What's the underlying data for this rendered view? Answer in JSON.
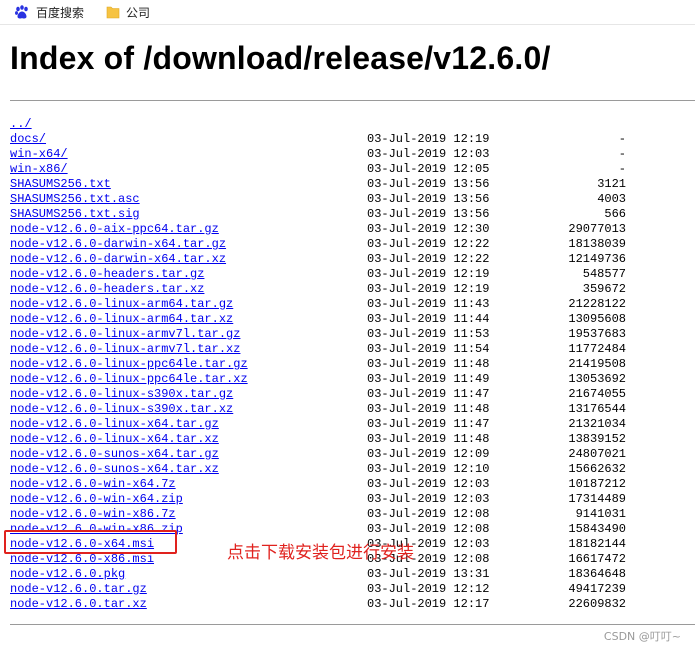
{
  "bookmarks": [
    {
      "label": "百度搜索",
      "icon": "paw-icon"
    },
    {
      "label": "公司",
      "icon": "folder-icon"
    }
  ],
  "page_title": "Index of /download/release/v12.6.0/",
  "entries": [
    {
      "name": "../",
      "date": "",
      "size": ""
    },
    {
      "name": "docs/",
      "date": "03-Jul-2019 12:19",
      "size": "-"
    },
    {
      "name": "win-x64/",
      "date": "03-Jul-2019 12:03",
      "size": "-"
    },
    {
      "name": "win-x86/",
      "date": "03-Jul-2019 12:05",
      "size": "-"
    },
    {
      "name": "SHASUMS256.txt",
      "date": "03-Jul-2019 13:56",
      "size": "3121"
    },
    {
      "name": "SHASUMS256.txt.asc",
      "date": "03-Jul-2019 13:56",
      "size": "4003"
    },
    {
      "name": "SHASUMS256.txt.sig",
      "date": "03-Jul-2019 13:56",
      "size": "566"
    },
    {
      "name": "node-v12.6.0-aix-ppc64.tar.gz",
      "date": "03-Jul-2019 12:30",
      "size": "29077013"
    },
    {
      "name": "node-v12.6.0-darwin-x64.tar.gz",
      "date": "03-Jul-2019 12:22",
      "size": "18138039"
    },
    {
      "name": "node-v12.6.0-darwin-x64.tar.xz",
      "date": "03-Jul-2019 12:22",
      "size": "12149736"
    },
    {
      "name": "node-v12.6.0-headers.tar.gz",
      "date": "03-Jul-2019 12:19",
      "size": "548577"
    },
    {
      "name": "node-v12.6.0-headers.tar.xz",
      "date": "03-Jul-2019 12:19",
      "size": "359672"
    },
    {
      "name": "node-v12.6.0-linux-arm64.tar.gz",
      "date": "03-Jul-2019 11:43",
      "size": "21228122"
    },
    {
      "name": "node-v12.6.0-linux-arm64.tar.xz",
      "date": "03-Jul-2019 11:44",
      "size": "13095608"
    },
    {
      "name": "node-v12.6.0-linux-armv7l.tar.gz",
      "date": "03-Jul-2019 11:53",
      "size": "19537683"
    },
    {
      "name": "node-v12.6.0-linux-armv7l.tar.xz",
      "date": "03-Jul-2019 11:54",
      "size": "11772484"
    },
    {
      "name": "node-v12.6.0-linux-ppc64le.tar.gz",
      "date": "03-Jul-2019 11:48",
      "size": "21419508"
    },
    {
      "name": "node-v12.6.0-linux-ppc64le.tar.xz",
      "date": "03-Jul-2019 11:49",
      "size": "13053692"
    },
    {
      "name": "node-v12.6.0-linux-s390x.tar.gz",
      "date": "03-Jul-2019 11:47",
      "size": "21674055"
    },
    {
      "name": "node-v12.6.0-linux-s390x.tar.xz",
      "date": "03-Jul-2019 11:48",
      "size": "13176544"
    },
    {
      "name": "node-v12.6.0-linux-x64.tar.gz",
      "date": "03-Jul-2019 11:47",
      "size": "21321034"
    },
    {
      "name": "node-v12.6.0-linux-x64.tar.xz",
      "date": "03-Jul-2019 11:48",
      "size": "13839152"
    },
    {
      "name": "node-v12.6.0-sunos-x64.tar.gz",
      "date": "03-Jul-2019 12:09",
      "size": "24807021"
    },
    {
      "name": "node-v12.6.0-sunos-x64.tar.xz",
      "date": "03-Jul-2019 12:10",
      "size": "15662632"
    },
    {
      "name": "node-v12.6.0-win-x64.7z",
      "date": "03-Jul-2019 12:03",
      "size": "10187212"
    },
    {
      "name": "node-v12.6.0-win-x64.zip",
      "date": "03-Jul-2019 12:03",
      "size": "17314489"
    },
    {
      "name": "node-v12.6.0-win-x86.7z",
      "date": "03-Jul-2019 12:08",
      "size": "9141031"
    },
    {
      "name": "node-v12.6.0-win-x86.zip",
      "date": "03-Jul-2019 12:08",
      "size": "15843490"
    },
    {
      "name": "node-v12.6.0-x64.msi",
      "date": "03-Jul-2019 12:03",
      "size": "18182144"
    },
    {
      "name": "node-v12.6.0-x86.msi",
      "date": "03-Jul-2019 12:08",
      "size": "16617472"
    },
    {
      "name": "node-v12.6.0.pkg",
      "date": "03-Jul-2019 13:31",
      "size": "18364648"
    },
    {
      "name": "node-v12.6.0.tar.gz",
      "date": "03-Jul-2019 12:12",
      "size": "49417239"
    },
    {
      "name": "node-v12.6.0.tar.xz",
      "date": "03-Jul-2019 12:17",
      "size": "22609832"
    }
  ],
  "annotation": {
    "text": "点击下载安装包进行安装",
    "color": "#e0221e"
  },
  "watermark": "CSDN @叮叮~",
  "colors": {
    "link": "#0000ee",
    "highlight": "#e0221e"
  }
}
